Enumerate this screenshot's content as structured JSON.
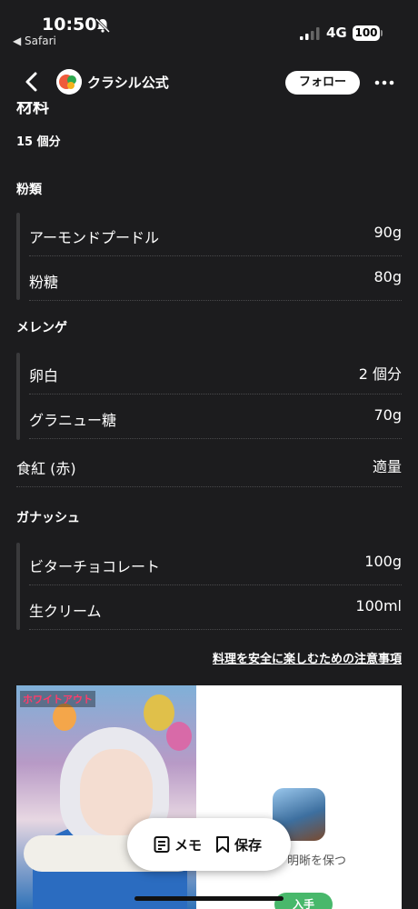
{
  "status_bar": {
    "time": "10:50",
    "back_app": "◀ Safari",
    "network": "4G",
    "battery": "100"
  },
  "nav": {
    "account_name": "クラシル公式",
    "follow_label": "フォロー"
  },
  "recipe": {
    "section_title": "材料",
    "servings": "15 個分",
    "groups": [
      {
        "title": "粉類",
        "items": [
          {
            "name": "アーモンドプードル",
            "qty": "90g"
          },
          {
            "name": "粉糖",
            "qty": "80g"
          }
        ]
      },
      {
        "title": "メレンゲ",
        "items": [
          {
            "name": "卵白",
            "qty": "2 個分"
          },
          {
            "name": "グラニュー糖",
            "qty": "70g"
          }
        ]
      }
    ],
    "standalone": {
      "name": "食紅 (赤)",
      "qty": "適量"
    },
    "ganache": {
      "title": "ガナッシュ",
      "items": [
        {
          "name": "ビターチョコレート",
          "qty": "100g"
        },
        {
          "name": "生クリーム",
          "qty": "100ml"
        }
      ]
    },
    "safety_link": "料理を安全に楽しむための注意事項"
  },
  "ad": {
    "logo_text": "ホワイトアウト",
    "tagline": "明晰を保つ",
    "cta": "入手"
  },
  "fab": {
    "memo_label": "メモ",
    "save_label": "保存"
  },
  "colors": {
    "background": "#1c1c1e",
    "cta_green": "#48b86b",
    "divider": "#4a4a4c"
  }
}
